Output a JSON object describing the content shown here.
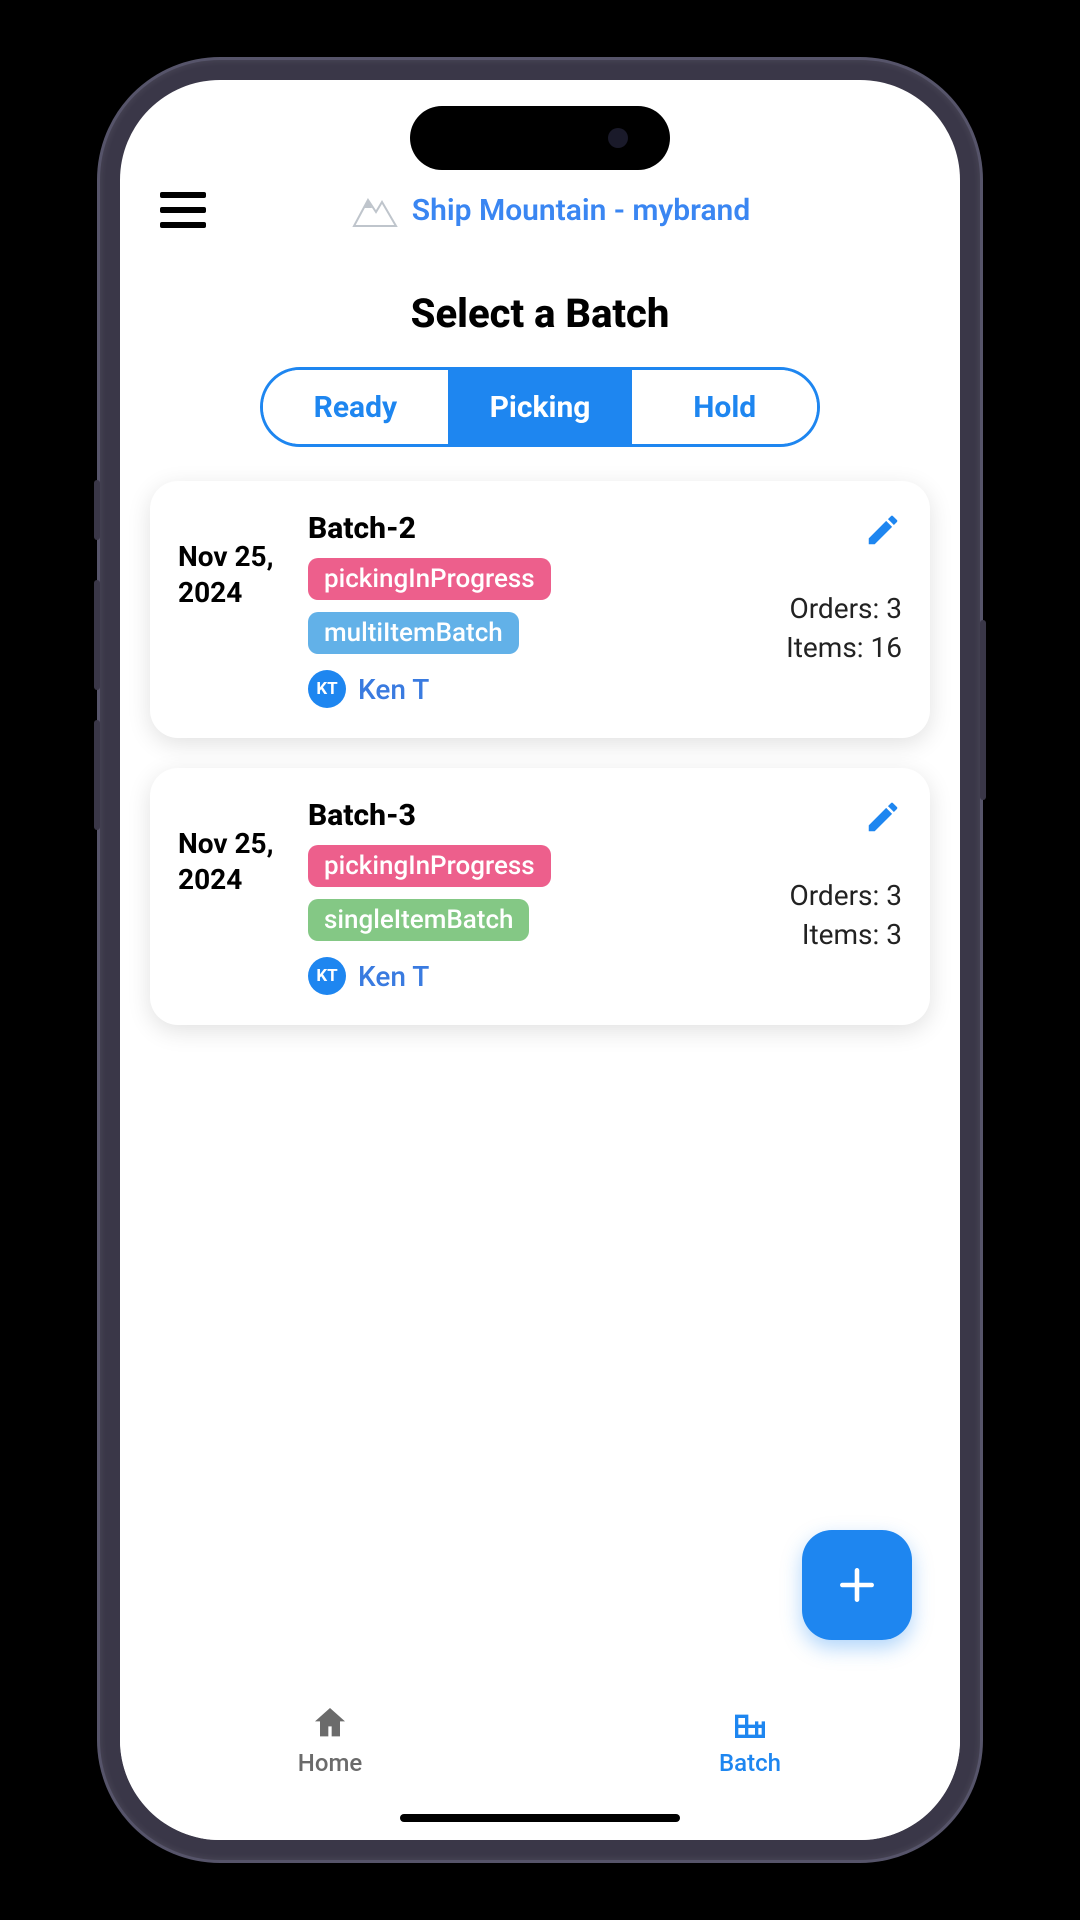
{
  "header": {
    "brand": "Ship Mountain - mybrand"
  },
  "page": {
    "title": "Select a Batch"
  },
  "tabs": {
    "items": [
      "Ready",
      "Picking",
      "Hold"
    ],
    "activeIndex": 1
  },
  "colors": {
    "accent": "#1E86F0",
    "tagPink": "#ed5f8c",
    "tagBlue": "#62b1e8",
    "tagGreen": "#84c885"
  },
  "batches": [
    {
      "date": "Nov 25, 2024",
      "name": "Batch-2",
      "statusTag": {
        "label": "pickingInProgress",
        "color": "pink"
      },
      "typeTag": {
        "label": "multiItemBatch",
        "color": "blue"
      },
      "assignee": {
        "initials": "KT",
        "name": "Ken T"
      },
      "orders": 3,
      "items": 16
    },
    {
      "date": "Nov 25, 2024",
      "name": "Batch-3",
      "statusTag": {
        "label": "pickingInProgress",
        "color": "pink"
      },
      "typeTag": {
        "label": "singleItemBatch",
        "color": "green"
      },
      "assignee": {
        "initials": "KT",
        "name": "Ken T"
      },
      "orders": 3,
      "items": 3
    }
  ],
  "labels": {
    "orders": "Orders",
    "items": "Items"
  },
  "bottomNav": {
    "home": "Home",
    "batch": "Batch",
    "activeIndex": 1
  }
}
